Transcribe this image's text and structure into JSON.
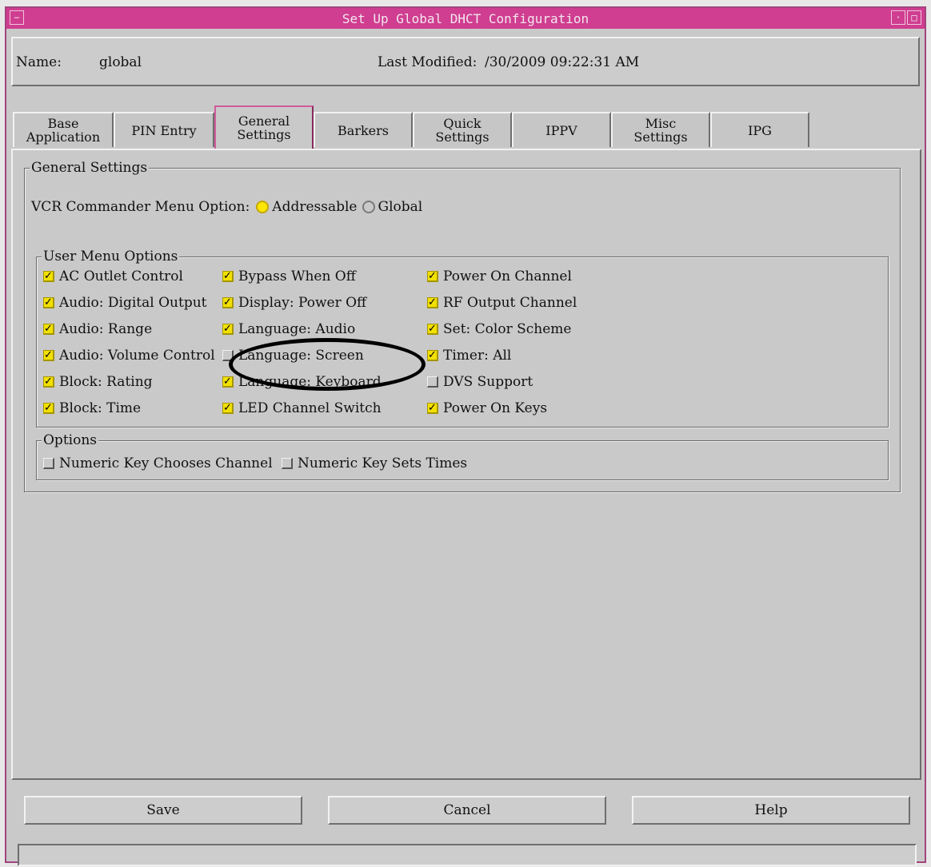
{
  "window": {
    "title": "Set Up Global DHCT Configuration"
  },
  "info": {
    "name_label": "Name:",
    "name_value": "global",
    "last_modified_label": "Last Modified:",
    "last_modified_value": "/30/2009 09:22:31 AM"
  },
  "tabs": [
    {
      "label": "Base\nApplication",
      "active": false
    },
    {
      "label": "PIN Entry",
      "active": false
    },
    {
      "label": "General\nSettings",
      "active": true
    },
    {
      "label": "Barkers",
      "active": false
    },
    {
      "label": "Quick\nSettings",
      "active": false
    },
    {
      "label": "IPPV",
      "active": false
    },
    {
      "label": "Misc\nSettings",
      "active": false
    },
    {
      "label": "IPG",
      "active": false
    }
  ],
  "general_settings": {
    "legend": "General Settings",
    "vcr_label": "VCR Commander Menu Option:",
    "vcr_options": [
      {
        "label": "Addressable",
        "selected": true
      },
      {
        "label": "Global",
        "selected": false
      }
    ]
  },
  "user_menu": {
    "legend": "User Menu Options",
    "columns": [
      [
        {
          "label": "AC Outlet Control",
          "checked": true
        },
        {
          "label": "Audio: Digital Output",
          "checked": true
        },
        {
          "label": "Audio: Range",
          "checked": true
        },
        {
          "label": "Audio: Volume Control",
          "checked": true
        },
        {
          "label": "Block: Rating",
          "checked": true
        },
        {
          "label": "Block: Time",
          "checked": true
        }
      ],
      [
        {
          "label": "Bypass When Off",
          "checked": true
        },
        {
          "label": "Display: Power Off",
          "checked": true
        },
        {
          "label": "Language: Audio",
          "checked": true
        },
        {
          "label": "Language: Screen",
          "checked": false
        },
        {
          "label": "Language: Keyboard",
          "checked": true
        },
        {
          "label": "LED Channel Switch",
          "checked": true
        }
      ],
      [
        {
          "label": "Power On Channel",
          "checked": true
        },
        {
          "label": "RF Output Channel",
          "checked": true
        },
        {
          "label": "Set: Color Scheme",
          "checked": true
        },
        {
          "label": "Timer: All",
          "checked": true
        },
        {
          "label": "DVS Support",
          "checked": false
        },
        {
          "label": "Power On Keys",
          "checked": true
        }
      ]
    ]
  },
  "options": {
    "legend": "Options",
    "items": [
      {
        "label": "Numeric Key Chooses Channel",
        "checked": false
      },
      {
        "label": "Numeric Key Sets Times",
        "checked": false
      }
    ]
  },
  "buttons": {
    "save": "Save",
    "cancel": "Cancel",
    "help": "Help"
  },
  "colors": {
    "titlebar": "#cf3e90",
    "selected": "#ffe600"
  }
}
